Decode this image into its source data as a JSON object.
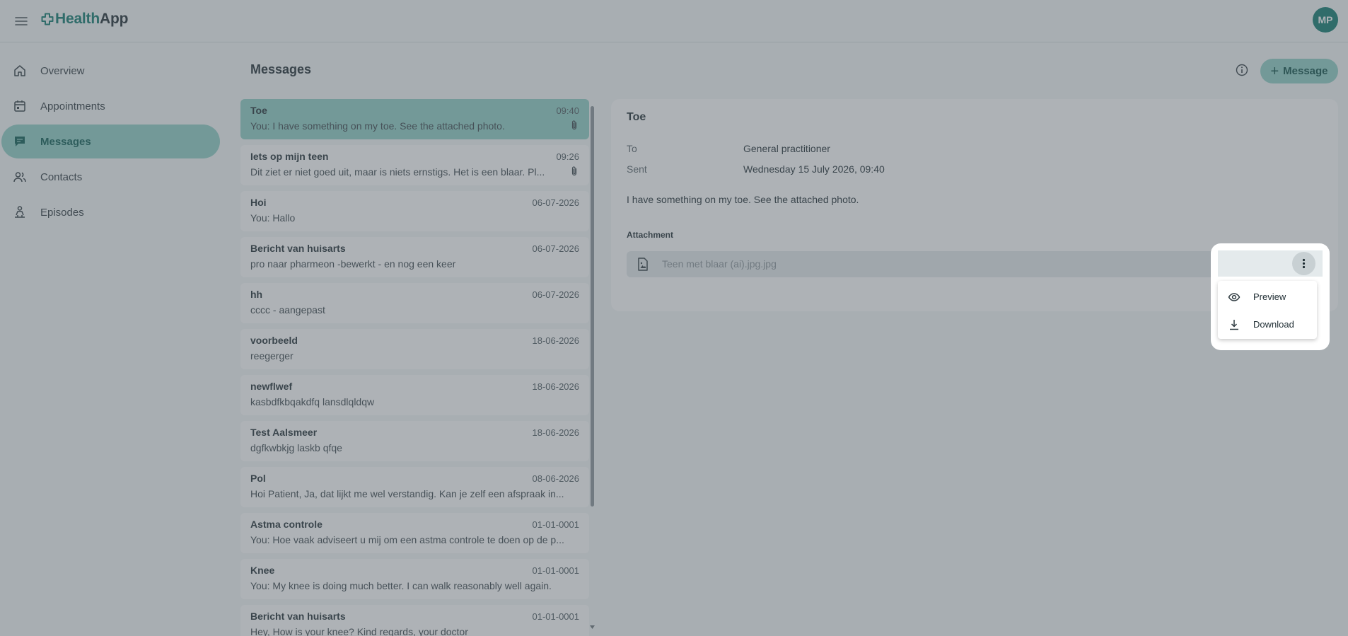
{
  "app": {
    "logo_part1": "Health",
    "logo_part2": "App",
    "user_initials": "MP"
  },
  "colors": {
    "brand": "#0e7a6e",
    "active_nav": "#8fd0c6",
    "selected_message": "#8fd0c6",
    "overlay": "#555f66"
  },
  "sidebar": {
    "items": [
      {
        "label": "Overview",
        "icon": "home-icon",
        "active": false
      },
      {
        "label": "Appointments",
        "icon": "calendar-icon",
        "active": false
      },
      {
        "label": "Messages",
        "icon": "chat-icon",
        "active": true
      },
      {
        "label": "Contacts",
        "icon": "people-icon",
        "active": false
      },
      {
        "label": "Episodes",
        "icon": "person-episode-icon",
        "active": false
      }
    ]
  },
  "page": {
    "title": "Messages",
    "new_message_label": "Message",
    "info_icon": "info-icon"
  },
  "messages": [
    {
      "subject": "Toe",
      "date": "09:40",
      "preview": "You: I have something on my toe. See the attached photo.",
      "attachment": true,
      "selected": true
    },
    {
      "subject": "Iets op mijn teen",
      "date": "09:26",
      "preview": "Dit ziet er niet goed uit, maar is niets ernstigs. Het is een blaar.  Pl...",
      "attachment": true,
      "selected": false
    },
    {
      "subject": "Hoi",
      "date": "06-07-2026",
      "preview": "You: Hallo",
      "attachment": false,
      "selected": false
    },
    {
      "subject": "Bericht van huisarts",
      "date": "06-07-2026",
      "preview": "pro naar pharmeon -bewerkt - en nog een keer",
      "attachment": false,
      "selected": false
    },
    {
      "subject": "hh",
      "date": "06-07-2026",
      "preview": "cccc - aangepast",
      "attachment": false,
      "selected": false
    },
    {
      "subject": "voorbeeld",
      "date": "18-06-2026",
      "preview": "reegerger",
      "attachment": false,
      "selected": false
    },
    {
      "subject": "newflwef",
      "date": "18-06-2026",
      "preview": "kasbdfkbqakdfq lansdlqldqw",
      "attachment": false,
      "selected": false
    },
    {
      "subject": "Test Aalsmeer",
      "date": "18-06-2026",
      "preview": "dgfkwbkjg laskb qfqe",
      "attachment": false,
      "selected": false
    },
    {
      "subject": "Pol",
      "date": "08-06-2026",
      "preview": "Hoi Patient, Ja, dat lijkt me wel verstandig. Kan je zelf een afspraak in...",
      "attachment": false,
      "selected": false
    },
    {
      "subject": "Astma controle",
      "date": "01-01-0001",
      "preview": "You: Hoe vaak adviseert u mij om een astma controle te doen op de p...",
      "attachment": false,
      "selected": false
    },
    {
      "subject": "Knee",
      "date": "01-01-0001",
      "preview": "You: My knee is doing much better. I can walk reasonably well again.",
      "attachment": false,
      "selected": false
    },
    {
      "subject": "Bericht van huisarts",
      "date": "01-01-0001",
      "preview": "Hey, How is your knee? Kind regards, your doctor",
      "attachment": false,
      "selected": false
    }
  ],
  "detail": {
    "subject": "Toe",
    "to_label": "To",
    "to_value": "General practitioner",
    "sent_label": "Sent",
    "sent_value": "Wednesday 15 July 2026, 09:40",
    "body": "I have something on my toe. See the attached photo.",
    "attachment_heading": "Attachment",
    "attachment_name": "Teen met blaar (ai).jpg.jpg"
  },
  "attachment_menu": {
    "items": [
      {
        "label": "Preview",
        "icon": "eye-icon"
      },
      {
        "label": "Download",
        "icon": "download-icon"
      }
    ]
  }
}
